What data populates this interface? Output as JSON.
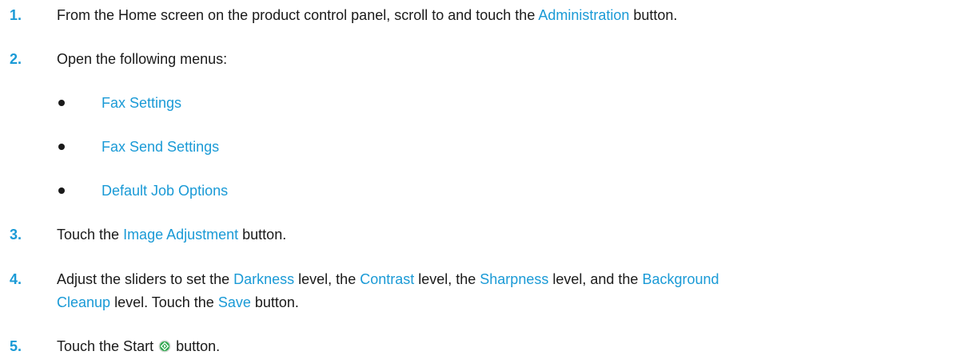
{
  "steps": [
    {
      "number": "1.",
      "before": "From the Home screen on the product control panel, scroll to and touch the ",
      "kw": "Administration",
      "after": " button."
    },
    {
      "number": "2.",
      "text": "Open the following menus:",
      "menus": [
        "Fax Settings",
        "Fax Send Settings",
        "Default Job Options"
      ]
    },
    {
      "number": "3.",
      "before": "Touch the ",
      "kw": "Image Adjustment",
      "after": " button."
    },
    {
      "number": "4.",
      "p1": "Adjust the sliders to set the ",
      "k1": "Darkness",
      "p2": " level, the ",
      "k2": "Contrast",
      "p3": " level, the ",
      "k3": "Sharpness",
      "p4": " level, and the ",
      "k4a": "Background",
      "k4b": "Cleanup",
      "p5": " level. Touch the ",
      "k5": "Save",
      "p6": " button."
    },
    {
      "number": "5.",
      "before": "Touch the Start ",
      "icon": "start-button-icon",
      "after": " button."
    }
  ],
  "colors": {
    "accent": "#1a9ad6",
    "start_icon_green": "#2aa84a"
  }
}
